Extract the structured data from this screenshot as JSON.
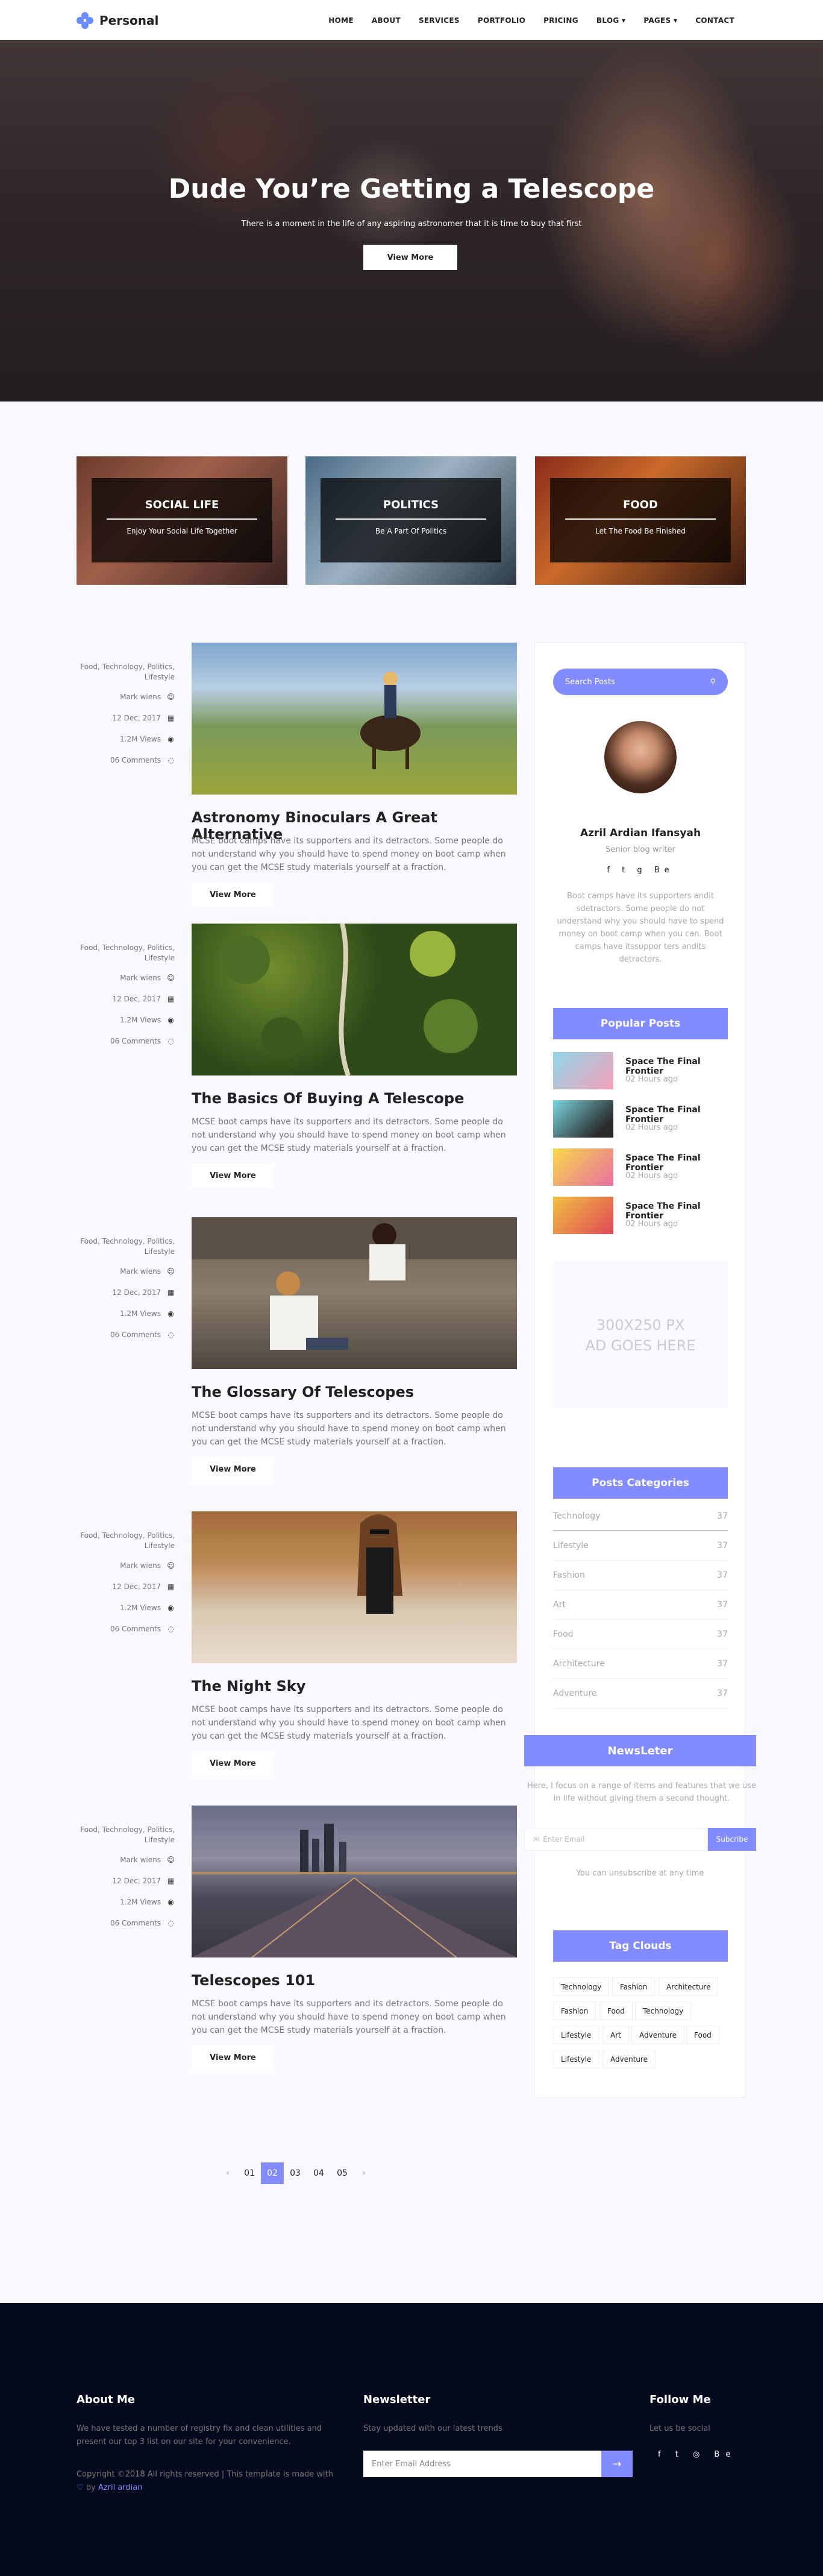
{
  "header": {
    "logo_text": "Personal",
    "nav": [
      "HOME",
      "ABOUT",
      "SERVICES",
      "PORTFOLIO",
      "PRICING",
      "BLOG ▾",
      "PAGES ▾",
      "CONTACT"
    ]
  },
  "hero": {
    "title": "Dude You’re Getting a Telescope",
    "subtitle": "There is a moment in the life of any aspiring astronomer that it is time to buy that first",
    "button": "View More"
  },
  "categories": [
    {
      "title": "SOCIAL LIFE",
      "subtitle": "Enjoy Your Social Life Together"
    },
    {
      "title": "POLITICS",
      "subtitle": "Be A Part Of Politics"
    },
    {
      "title": "FOOD",
      "subtitle": "Let The Food Be Finished"
    }
  ],
  "posts": [
    {
      "tags": "Food, Technology, Politics, Lifestyle",
      "author": "Mark wiens",
      "date": "12 Dec, 2017",
      "views": "1.2M Views",
      "comments": "06 Comments",
      "title": "Astronomy Binoculars A Great Alternative",
      "text": "MCSE boot camps have its supporters and its detractors. Some people do not understand why you should have to spend money on boot camp when you can get the MCSE study materials yourself at a fraction.",
      "button": "View More"
    },
    {
      "tags": "Food, Technology, Politics, Lifestyle",
      "author": "Mark wiens",
      "date": "12 Dec, 2017",
      "views": "1.2M Views",
      "comments": "06 Comments",
      "title": "The Basics Of Buying A Telescope",
      "text": "MCSE boot camps have its supporters and its detractors. Some people do not understand why you should have to spend money on boot camp when you can get the MCSE study materials yourself at a fraction.",
      "button": "View More"
    },
    {
      "tags": "Food, Technology, Politics, Lifestyle",
      "author": "Mark wiens",
      "date": "12 Dec, 2017",
      "views": "1.2M Views",
      "comments": "06 Comments",
      "title": "The Glossary Of Telescopes",
      "text": "MCSE boot camps have its supporters and its detractors. Some people do not understand why you should have to spend money on boot camp when you can get the MCSE study materials yourself at a fraction.",
      "button": "View More"
    },
    {
      "tags": "Food, Technology, Politics, Lifestyle",
      "author": "Mark wiens",
      "date": "12 Dec, 2017",
      "views": "1.2M Views",
      "comments": "06 Comments",
      "title": "The Night Sky",
      "text": "MCSE boot camps have its supporters and its detractors. Some people do not understand why you should have to spend money on boot camp when you can get the MCSE study materials yourself at a fraction.",
      "button": "View More"
    },
    {
      "tags": "Food, Technology, Politics, Lifestyle",
      "author": "Mark wiens",
      "date": "12 Dec, 2017",
      "views": "1.2M Views",
      "comments": "06 Comments",
      "title": "Telescopes 101",
      "text": "MCSE boot camps have its supporters and its detractors. Some people do not understand why you should have to spend money on boot camp when you can get the MCSE study materials yourself at a fraction.",
      "button": "View More"
    }
  ],
  "sidebar": {
    "search_placeholder": "Search Posts",
    "author_name": "Azril Ardian Ifansyah",
    "author_role": "Senior blog writer",
    "author_social": "f  t  g  Be",
    "author_bio": "Boot camps have its supporters andit sdetractors. Some people do not understand why you should have to spend money on boot camp when you can. Boot camps have itssuppor ters andits detractors.",
    "popular_title": "Popular Posts",
    "popular": [
      {
        "title": "Space The Final Frontier",
        "time": "02 Hours ago"
      },
      {
        "title": "Space The Final Frontier",
        "time": "02 Hours ago"
      },
      {
        "title": "Space The Final Frontier",
        "time": "02 Hours ago"
      },
      {
        "title": "Space The Final Frontier",
        "time": "02 Hours ago"
      }
    ],
    "ad_line1": "300X250 PX",
    "ad_line2": "AD GOES HERE",
    "categories_title": "Posts Categories",
    "categories": [
      {
        "name": "Technology",
        "count": "37"
      },
      {
        "name": "Lifestyle",
        "count": "37"
      },
      {
        "name": "Fashion",
        "count": "37"
      },
      {
        "name": "Art",
        "count": "37"
      },
      {
        "name": "Food",
        "count": "37"
      },
      {
        "name": "Architecture",
        "count": "37"
      },
      {
        "name": "Adventure",
        "count": "37"
      }
    ],
    "newsletter_title": "NewsLeter",
    "newsletter_text": "Here, I focus on a range of items and features that we use in life without giving them a second thought.",
    "newsletter_placeholder": "Enter Email",
    "newsletter_button": "Subcribe",
    "newsletter_note": "You can unsubscribe at any time",
    "tags_title": "Tag Clouds",
    "tags": [
      "Technology",
      "Fashion",
      "Architecture",
      "Fashion",
      "Food",
      "Technology",
      "Lifestyle",
      "Art",
      "Adventure",
      "Food",
      "Lifestyle",
      "Adventure"
    ]
  },
  "pagination": {
    "prev": "‹",
    "pages": [
      "01",
      "02",
      "03",
      "04",
      "05"
    ],
    "active": "02",
    "next": "›"
  },
  "footer": {
    "about_title": "About Me",
    "about_text": "We have tested a number of registry fix and clean utilities and present our top 3 list on our site for your convenience.",
    "copyright": "Copyright ©2018 All rights reserved | This template is made with",
    "credit_by": "by",
    "credit_name": "Azril ardian",
    "newsletter_title": "Newsletter",
    "newsletter_text": "Stay updated with our latest trends",
    "newsletter_placeholder": "Enter Email Address",
    "follow_title": "Follow Me",
    "follow_text": "Let us be social",
    "follow_social": "f t ◎ Be"
  },
  "colors": {
    "accent": "#828bff",
    "footer_bg": "#04091e",
    "page_bg": "#f9f9ff"
  }
}
